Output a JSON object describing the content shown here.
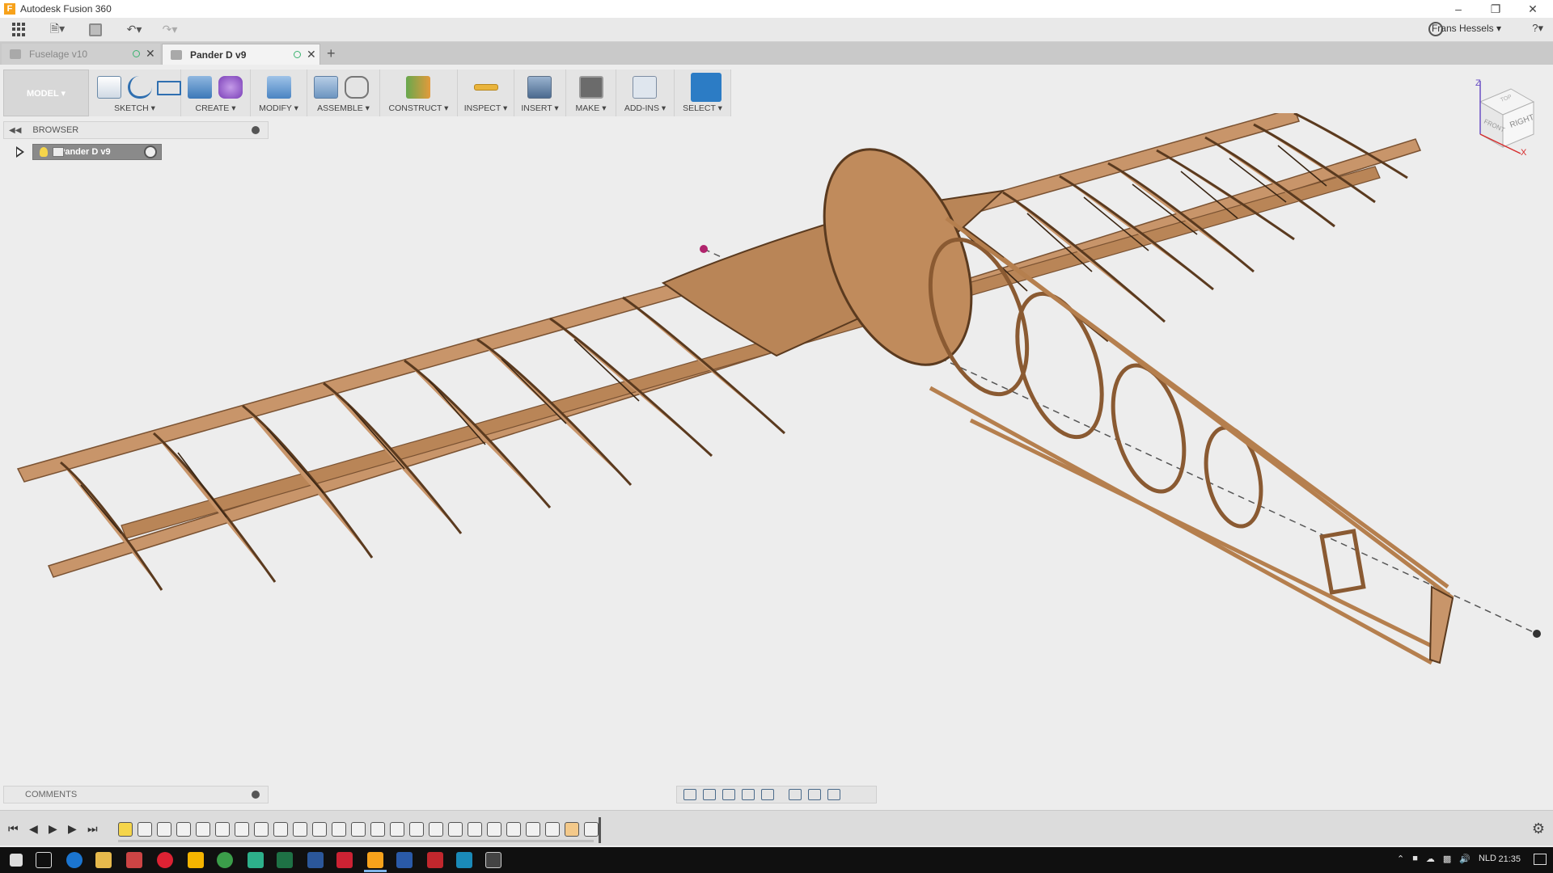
{
  "window": {
    "title": "Autodesk Fusion 360",
    "app_icon_letter": "F"
  },
  "qat": {
    "user_name": "Frans Hessels ▾",
    "help": "?▾"
  },
  "tabs": [
    {
      "label": "Fuselage v10",
      "active": false
    },
    {
      "label": "Pander D v9",
      "active": true
    }
  ],
  "toolbar": {
    "workspace": "MODEL ▾",
    "groups": [
      {
        "label": "SKETCH ▾"
      },
      {
        "label": "CREATE ▾"
      },
      {
        "label": "MODIFY ▾"
      },
      {
        "label": "ASSEMBLE ▾"
      },
      {
        "label": "CONSTRUCT ▾"
      },
      {
        "label": "INSPECT ▾"
      },
      {
        "label": "INSERT ▾"
      },
      {
        "label": "MAKE ▾"
      },
      {
        "label": "ADD-INS ▾"
      },
      {
        "label": "SELECT ▾"
      }
    ]
  },
  "browser": {
    "title": "BROWSER",
    "root_node": "Pander D v9"
  },
  "comments": {
    "title": "COMMENTS"
  },
  "viewcube": {
    "right": "RIGHT",
    "front": "FRONT",
    "top": "TOP",
    "axis_z": "Z",
    "axis_x": "X"
  },
  "taskbar": {
    "language": "NLD",
    "time": "21:35"
  },
  "colors": {
    "accent": "#2c7cc5",
    "wood": "#c8956a",
    "wood_dark": "#7a5232",
    "background": "#ededed"
  }
}
